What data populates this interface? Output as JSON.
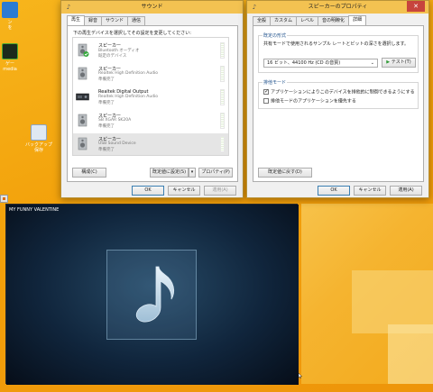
{
  "desktop": {
    "icons": [
      {
        "label": "ン\nを"
      },
      {
        "label": "ゲー\nmedia"
      },
      {
        "label": "バックアップ\n保存"
      }
    ]
  },
  "sound_window": {
    "title": "サウンド",
    "tabs": [
      "再生",
      "録音",
      "サウンド",
      "通信"
    ],
    "instruction": "下の再生デバイスを選択してその設定を変更してください:",
    "devices": [
      {
        "name": "スピーカー",
        "sub": "Bluetooth オーディオ",
        "status": "既定のデバイス"
      },
      {
        "name": "スピーカー",
        "sub": "Realtek High Definition Audio",
        "status": "準備完了"
      },
      {
        "name": "Realtek Digital Output",
        "sub": "Realtek High Definition Audio",
        "status": "準備完了"
      },
      {
        "name": "スピーカー",
        "sub": "SB XGAR SK20A",
        "status": "準備完了"
      },
      {
        "name": "スピーカー",
        "sub": "USB Sound Device",
        "status": "準備完了"
      }
    ],
    "buttons": {
      "configure": "構成(C)",
      "set_default": "既定値に設定(S)",
      "properties": "プロパティ(P)",
      "ok": "OK",
      "cancel": "キャンセル",
      "apply": "適用(A)"
    }
  },
  "properties_window": {
    "title": "スピーカーのプロパティ",
    "tabs": [
      "全般",
      "カスタム",
      "レベル",
      "音の明瞭化",
      "詳細"
    ],
    "default_format": {
      "label": "既定の形式",
      "description": "共有モードで使用されるサンプル レートとビットの深さを選択します。",
      "selected": "16 ビット、44100 Hz (CD の音質)",
      "test_button": "テスト(T)"
    },
    "exclusive_mode": {
      "label": "排他モード",
      "options": [
        {
          "label": "アプリケーションによりこのデバイスを排他的に制御できるようにする",
          "checked": true
        },
        {
          "label": "排他モードのアプリケーションを優先する",
          "checked": false
        }
      ]
    },
    "buttons": {
      "restore": "既定値に戻す(D)",
      "ok": "OK",
      "cancel": "キャンセル",
      "apply": "適用(A)"
    }
  },
  "media_player": {
    "track_title": "MY FUNNY VALENTINE"
  },
  "colors": {
    "titlebar": "#f3c251",
    "close": "#c7443d",
    "desktop": "#f2a60a"
  }
}
